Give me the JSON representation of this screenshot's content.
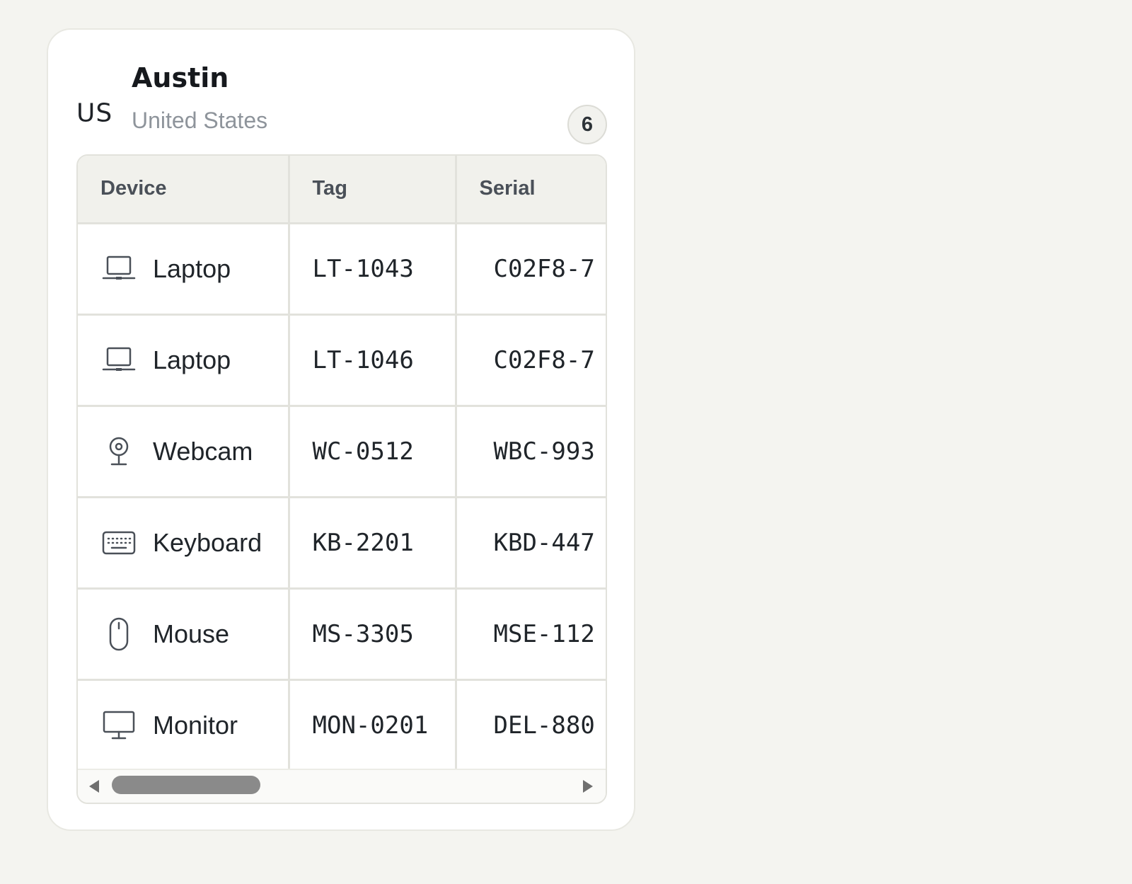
{
  "location": {
    "country_code": "US",
    "city": "Austin",
    "country": "United States",
    "device_count": "6"
  },
  "table": {
    "headers": [
      "Device",
      "Tag",
      "Serial"
    ],
    "rows": [
      {
        "icon": "laptop-icon",
        "device": "Laptop",
        "tag": "LT-1043",
        "serial": "C02F8-7"
      },
      {
        "icon": "laptop-icon",
        "device": "Laptop",
        "tag": "LT-1046",
        "serial": "C02F8-7"
      },
      {
        "icon": "webcam-icon",
        "device": "Webcam",
        "tag": "WC-0512",
        "serial": "WBC-993"
      },
      {
        "icon": "keyboard-icon",
        "device": "Keyboard",
        "tag": "KB-2201",
        "serial": "KBD-447"
      },
      {
        "icon": "mouse-icon",
        "device": "Mouse",
        "tag": "MS-3305",
        "serial": "MSE-112"
      },
      {
        "icon": "monitor-icon",
        "device": "Monitor",
        "tag": "MON-0201",
        "serial": "DEL-880"
      }
    ]
  },
  "scrollbar": {
    "position": 0.0
  },
  "colors": {
    "background": "#f4f4f0",
    "card": "#ffffff",
    "header_row": "#f1f1ec",
    "border": "#e2e2dc",
    "icon_stroke": "#4a5058",
    "muted_text": "#8e949b"
  }
}
